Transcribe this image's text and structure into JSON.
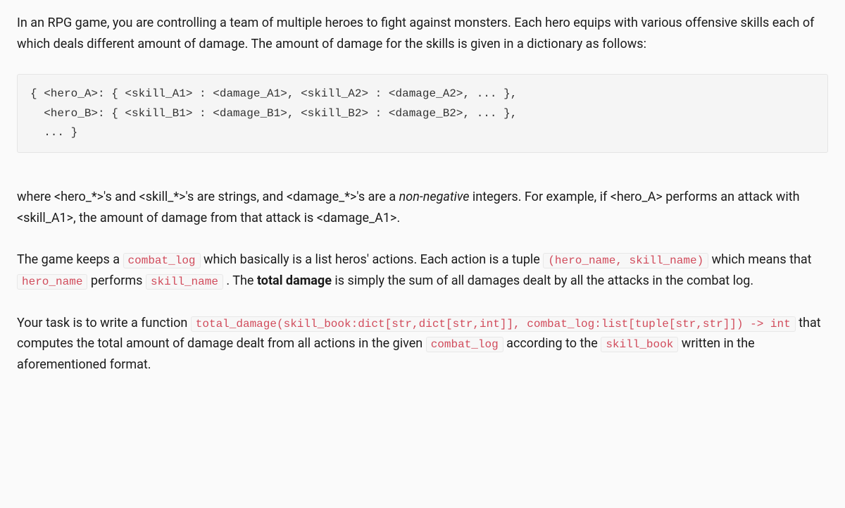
{
  "intro": {
    "p1": "In an RPG game, you are controlling a team of multiple heroes to fight against monsters. Each hero equips with various offensive skills each of which deals different amount of damage. The amount of damage for the skills is given in a dictionary as follows:"
  },
  "code_block": "{ <hero_A>: { <skill_A1> : <damage_A1>, <skill_A2> : <damage_A2>, ... },\n  <hero_B>: { <skill_B1> : <damage_B1>, <skill_B2> : <damage_B2>, ... },\n  ... }",
  "explain": {
    "seg1": "where <hero_*>'s and <skill_*>'s are strings, and <damage_*>'s are a ",
    "nonneg": "non-negative",
    "seg2": " integers. For example, if <hero_A> performs an attack with <skill_A1>, the amount of damage from that attack is <damage_A1>."
  },
  "para2": {
    "seg1": "The game keeps a ",
    "code_combat_log": "combat_log",
    "seg2": " which basically is a list heros' actions. Each action is a tuple ",
    "code_tuple": "(hero_name, skill_name)",
    "seg3": " which means that ",
    "code_hero_name": "hero_name",
    "seg4": " performs ",
    "code_skill_name": "skill_name",
    "seg5": " . The ",
    "bold_total": "total damage",
    "seg6": " is simply the sum of all damages dealt by all the attacks in the combat log."
  },
  "para3": {
    "seg1": "Your task is to write a function ",
    "code_func": "total_damage(skill_book:dict[str,dict[str,int]], combat_log:list[tuple[str,str]]) -> int",
    "seg2": " that computes the total amount of damage dealt from all actions in the given ",
    "code_combat_log2": "combat_log",
    "seg3": " according to the ",
    "code_skill_book": "skill_book",
    "seg4": " written in the aforementioned format."
  }
}
